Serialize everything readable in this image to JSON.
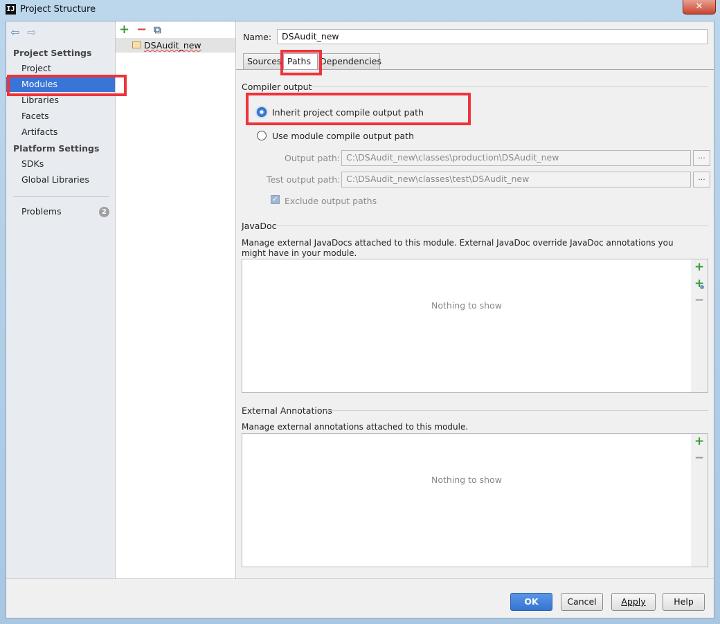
{
  "window": {
    "title": "Project Structure",
    "app_icon": "IJ",
    "close_glyph": "✕"
  },
  "nav": {
    "back_glyph": "⇦",
    "forward_glyph": "⇨"
  },
  "sidebar": {
    "project_settings_heading": "Project Settings",
    "platform_settings_heading": "Platform Settings",
    "items": [
      {
        "label": "Project"
      },
      {
        "label": "Modules",
        "selected": true
      },
      {
        "label": "Libraries"
      },
      {
        "label": "Facets"
      },
      {
        "label": "Artifacts"
      },
      {
        "label": "SDKs"
      },
      {
        "label": "Global Libraries"
      },
      {
        "label": "Problems",
        "badge": "2"
      }
    ]
  },
  "modules_panel": {
    "add_glyph": "+",
    "remove_glyph": "−",
    "copy_glyph": "⧉",
    "modules": [
      {
        "name": "DSAudit_new",
        "selected": true
      }
    ]
  },
  "detail": {
    "name_label": "Name:",
    "name_value": "DSAudit_new",
    "tabs": [
      {
        "label": "Sources"
      },
      {
        "label": "Paths",
        "active": true
      },
      {
        "label": "Dependencies"
      }
    ],
    "compiler_output": {
      "title": "Compiler output",
      "inherit_label": "Inherit project compile output path",
      "inherit_selected": true,
      "module_label": "Use module compile output path",
      "output_path_label": "Output path:",
      "output_path_value": "C:\\DSAudit_new\\classes\\production\\DSAudit_new",
      "test_output_path_label": "Test output path:",
      "test_output_path_value": "C:\\DSAudit_new\\classes\\test\\DSAudit_new",
      "browse_label": "...",
      "exclude_label": "Exclude output paths",
      "exclude_checked": true
    },
    "javadoc": {
      "title": "JavaDoc",
      "description": "Manage external JavaDocs attached to this module. External JavaDoc override JavaDoc annotations you might have in your module.",
      "empty_text": "Nothing to show"
    },
    "external_annotations": {
      "title": "External Annotations",
      "description": "Manage external annotations attached to this module.",
      "empty_text": "Nothing to show"
    }
  },
  "buttons": {
    "ok": "OK",
    "cancel": "Cancel",
    "apply": "Apply",
    "help": "Help"
  },
  "colors": {
    "selection": "#3875d7",
    "highlight": "#f0323a",
    "accent_green": "#3a9a3a",
    "remove_red": "#d84040"
  }
}
